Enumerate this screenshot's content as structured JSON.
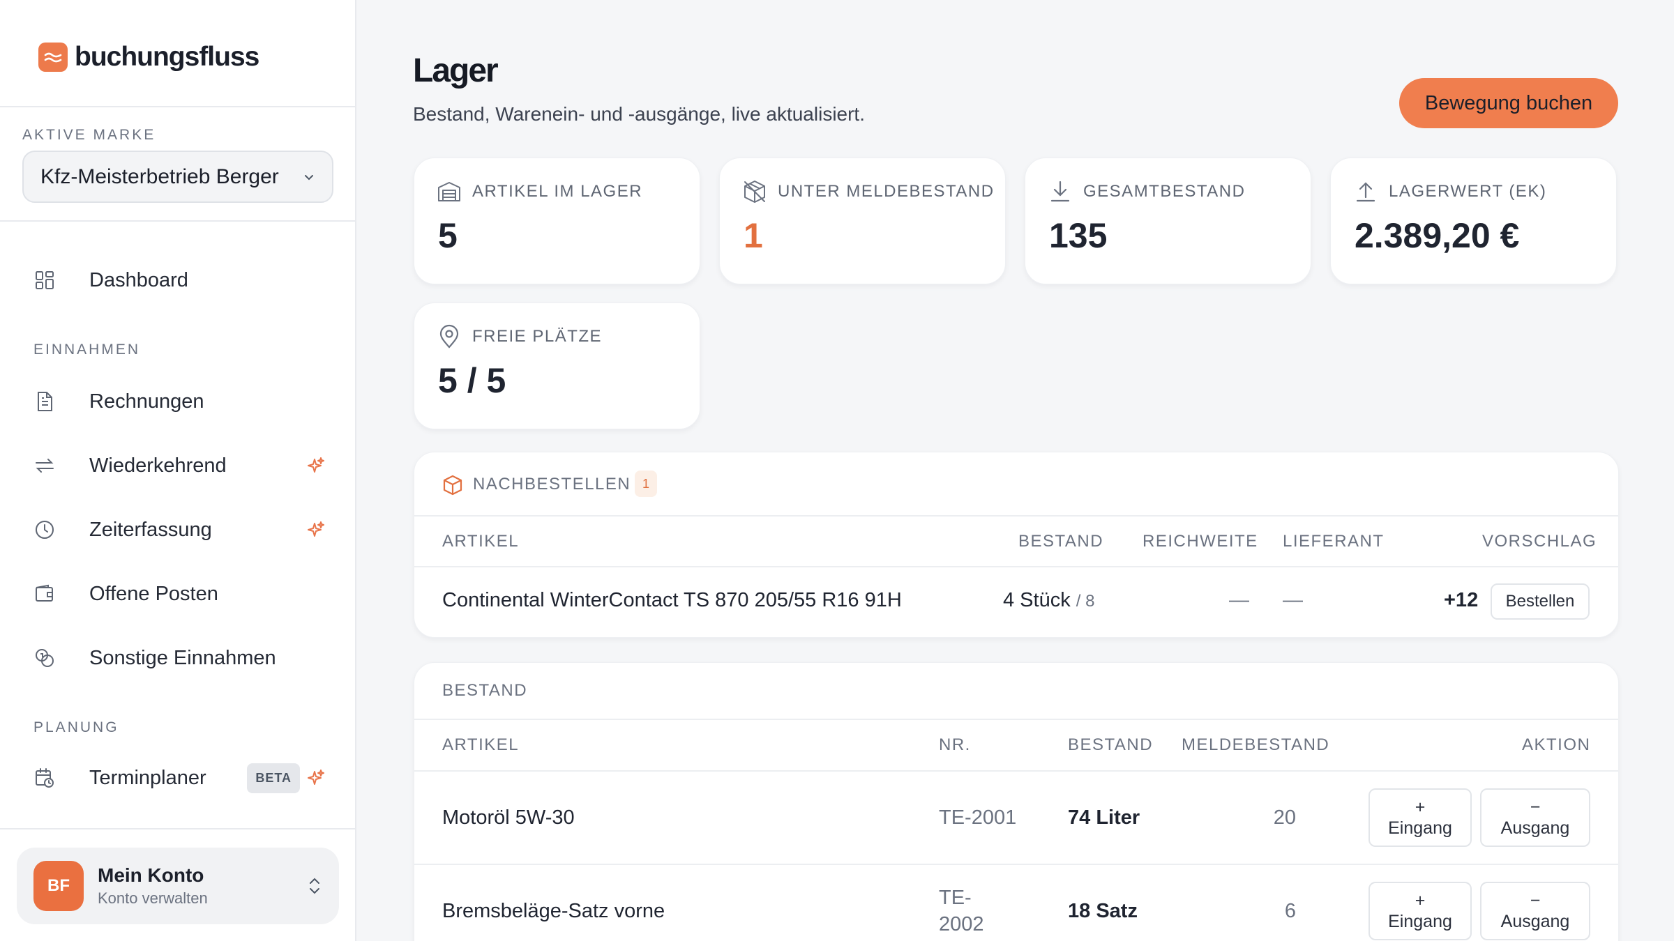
{
  "sidebar": {
    "brand": "buchungsfluss",
    "active_brand_label": "AKTIVE MARKE",
    "active_brand_value": "Kfz-Meisterbetrieb Berger",
    "nav": {
      "dashboard": "Dashboard",
      "section_income": "EINNAHMEN",
      "invoices": "Rechnungen",
      "recurring": "Wiederkehrend",
      "time_tracking": "Zeiterfassung",
      "open_items": "Offene Posten",
      "other_income": "Sonstige Einnahmen",
      "section_planning": "PLANUNG",
      "scheduler": "Terminplaner",
      "scheduler_badge": "BETA"
    },
    "account": {
      "initials": "BF",
      "name": "Mein Konto",
      "subtitle": "Konto verwalten"
    }
  },
  "header": {
    "title": "Lager",
    "subtitle": "Bestand, Warenein- und -ausgänge, live aktualisiert.",
    "primary_action": "Bewegung buchen"
  },
  "stats": [
    {
      "label": "ARTIKEL IM LAGER",
      "value": "5",
      "icon": "warehouse-icon"
    },
    {
      "label": "UNTER MELDEBESTAND",
      "value": "1",
      "icon": "package-alert-icon"
    },
    {
      "label": "GESAMTBESTAND",
      "value": "135",
      "icon": "download-icon"
    },
    {
      "label": "LAGERWERT (EK)",
      "value": "2.389,20 €",
      "icon": "upload-icon"
    },
    {
      "label": "FREIE PLÄTZE",
      "value": "5 / 5",
      "icon": "location-pin-icon"
    }
  ],
  "colors": {
    "accent": "#f07e4e",
    "warning_text": "#e2703f"
  },
  "reorder": {
    "title": "NACHBESTELLEN",
    "count": "1",
    "columns": {
      "article": "ARTIKEL",
      "stock": "BESTAND",
      "range": "REICHWEITE",
      "supplier": "LIEFERANT",
      "suggestion": "VORSCHLAG"
    },
    "rows": [
      {
        "article": "Continental WinterContact TS 870 205/55 R16 91H",
        "stock": "4 Stück",
        "stock_min": "/ 8",
        "range": "—",
        "supplier": "—",
        "suggestion": "+12",
        "action": "Bestellen"
      }
    ]
  },
  "inventory": {
    "title": "BESTAND",
    "columns": {
      "article": "ARTIKEL",
      "number": "NR.",
      "stock": "BESTAND",
      "reorder_level": "MELDEBESTAND",
      "action": "AKTION"
    },
    "rows": [
      {
        "article": "Motoröl 5W-30",
        "number": "TE-2001",
        "stock": "74 Liter",
        "reorder_level": "20",
        "in_sign": "+",
        "in_label": "Eingang",
        "out_sign": "−",
        "out_label": "Ausgang"
      },
      {
        "article": "Bremsbeläge-Satz vorne",
        "number_line1": "TE-",
        "number_line2": "2002",
        "stock": "18 Satz",
        "reorder_level": "6",
        "in_sign": "+",
        "in_label": "Eingang",
        "out_sign": "−",
        "out_label": "Ausgang"
      }
    ]
  }
}
